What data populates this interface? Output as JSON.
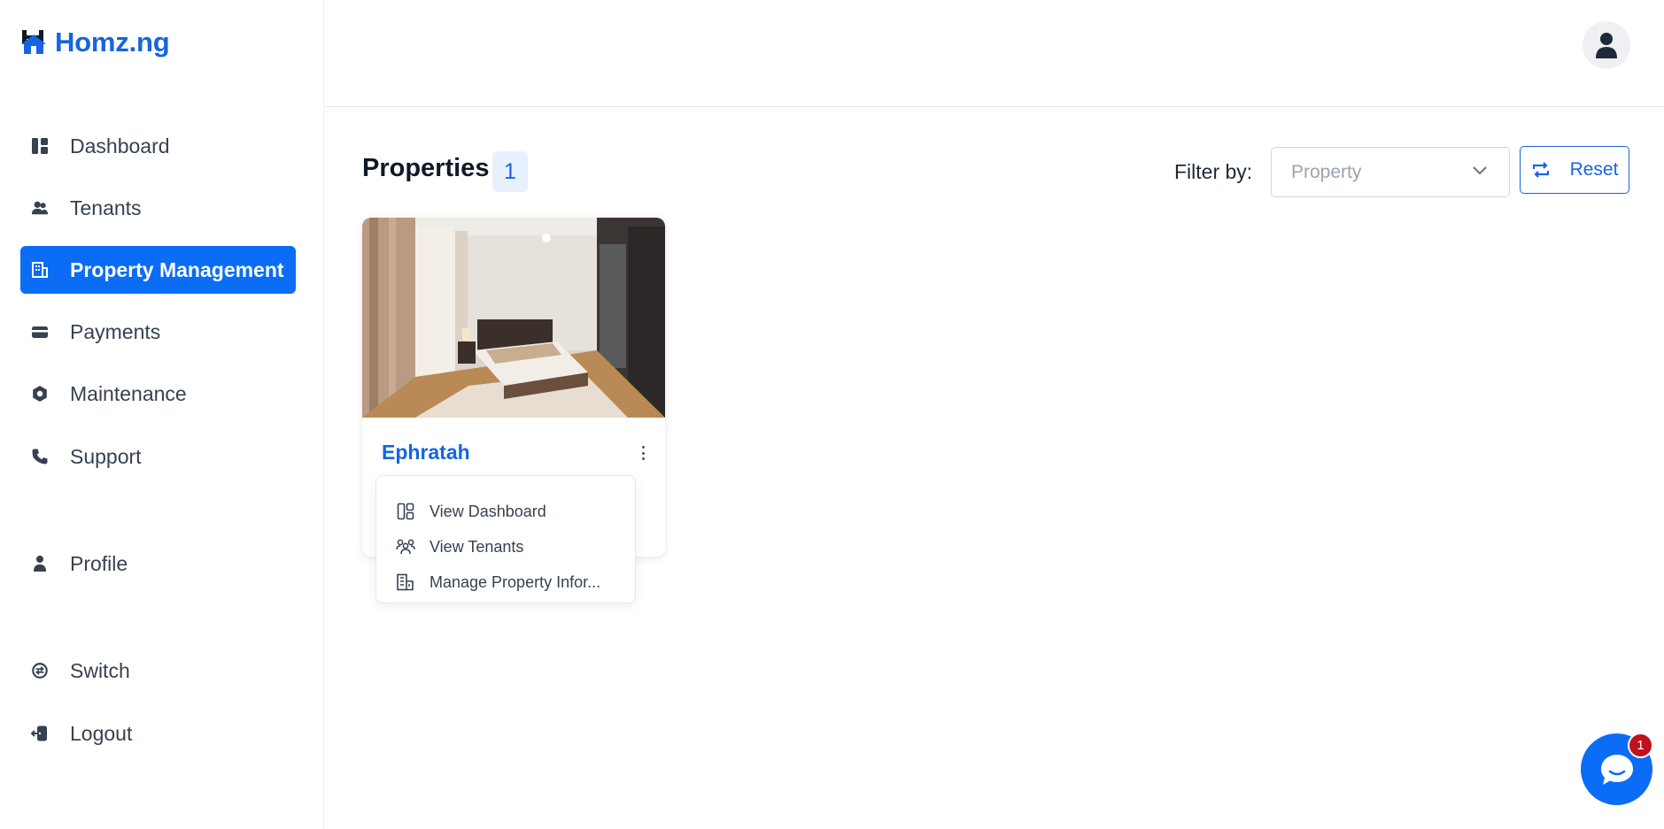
{
  "brand": {
    "name": "Homz.ng",
    "color": "#1565e0"
  },
  "sidebar": {
    "items": [
      {
        "label": "Dashboard",
        "icon": "dashboard-icon"
      },
      {
        "label": "Tenants",
        "icon": "users-icon"
      },
      {
        "label": "Property Management",
        "icon": "building-icon",
        "active": true
      },
      {
        "label": "Payments",
        "icon": "wallet-icon"
      },
      {
        "label": "Maintenance",
        "icon": "gear-icon"
      },
      {
        "label": "Support",
        "icon": "phone-icon"
      },
      {
        "label": "Profile",
        "icon": "person-icon"
      },
      {
        "label": "Switch",
        "icon": "switch-icon"
      },
      {
        "label": "Logout",
        "icon": "logout-icon"
      }
    ],
    "active_color": "#0b6cf5"
  },
  "main": {
    "title": "Properties",
    "count": "1",
    "filter": {
      "label": "Filter by:",
      "select_placeholder": "Property",
      "reset_label": "Reset"
    },
    "property_card": {
      "name": "Ephratah",
      "image": "bedroom-photo"
    },
    "card_menu": {
      "items": [
        {
          "label": "View Dashboard",
          "icon": "dashboard-outline-icon"
        },
        {
          "label": "View Tenants",
          "icon": "users-outline-icon"
        },
        {
          "label": "Manage Property Infor...",
          "icon": "building-outline-icon"
        }
      ]
    }
  },
  "chat": {
    "badge_count": "1",
    "color": "#0b6cf5"
  }
}
